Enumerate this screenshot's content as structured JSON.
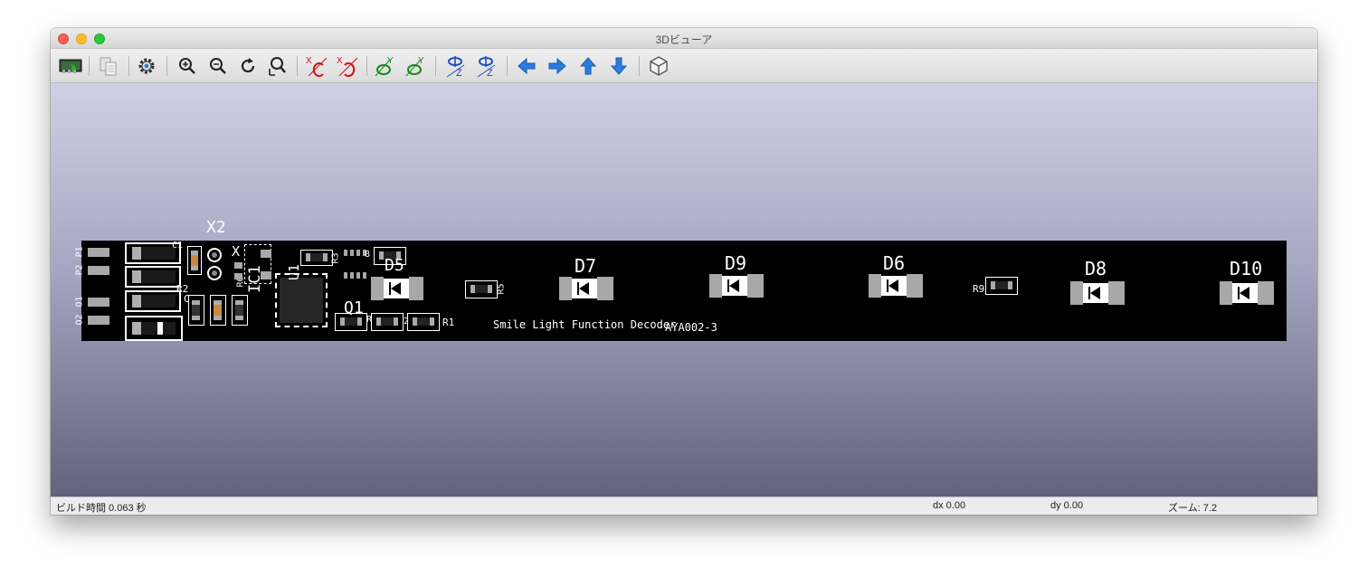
{
  "window": {
    "title": "3Dビューア"
  },
  "toolbar": {
    "buttons": [
      {
        "name": "reload-board-button",
        "icon": "reload-board-icon"
      },
      {
        "name": "copy-image-button",
        "icon": "copy-icon"
      },
      {
        "name": "settings-button",
        "icon": "gear-icon"
      },
      {
        "name": "zoom-in-button",
        "icon": "zoom-in-icon"
      },
      {
        "name": "zoom-out-button",
        "icon": "zoom-out-icon"
      },
      {
        "name": "redraw-button",
        "icon": "redraw-icon"
      },
      {
        "name": "zoom-fit-button",
        "icon": "zoom-fit-icon"
      },
      {
        "name": "rotate-x-cw-button",
        "icon": "rotate-x-icon",
        "axis": "X"
      },
      {
        "name": "rotate-x-ccw-button",
        "icon": "rotate-x-icon",
        "axis": "X"
      },
      {
        "name": "rotate-y-cw-button",
        "icon": "rotate-y-icon",
        "axis": "Y"
      },
      {
        "name": "rotate-y-ccw-button",
        "icon": "rotate-y-icon",
        "axis": "Y"
      },
      {
        "name": "rotate-z-cw-button",
        "icon": "rotate-z-icon",
        "axis": "Z"
      },
      {
        "name": "rotate-z-ccw-button",
        "icon": "rotate-z-icon",
        "axis": "Z"
      },
      {
        "name": "move-left-button",
        "icon": "arrow-left-icon"
      },
      {
        "name": "move-right-button",
        "icon": "arrow-right-icon"
      },
      {
        "name": "move-up-button",
        "icon": "arrow-up-icon"
      },
      {
        "name": "move-down-button",
        "icon": "arrow-down-icon"
      },
      {
        "name": "ortho-view-button",
        "icon": "cube-icon"
      }
    ]
  },
  "board": {
    "text": {
      "title": "Smile Light Function Decoder",
      "code": "AYA002-3"
    },
    "refs": {
      "x2": "X2",
      "p1": "P1",
      "p2": "P2",
      "o1": "O1",
      "o2": "O2",
      "c1": "C1",
      "r2": "R2",
      "r6": "R6",
      "x": "X",
      "ic1": "IC1",
      "u1": "U1",
      "r3": "R3",
      "r8": "8",
      "q1": "Q1",
      "r1": "R1",
      "r5": "R5",
      "r9": "R9",
      "c2": "C",
      "d5": "D5",
      "d7": "D7",
      "d9": "D9",
      "d6": "D6",
      "d8": "D8",
      "d10": "D10",
      "small_a": "R",
      "small_b": "2"
    },
    "colors": {
      "board": "#000000",
      "pad": "#a8a8a8",
      "silkscreen": "#ffffff",
      "ceramic": "#c98a3c"
    }
  },
  "status": {
    "build_time": "ビルド時間 0.063 秒",
    "dx": "dx 0.00",
    "dy": "dy 0.00",
    "zoom": "ズーム: 7.2"
  }
}
